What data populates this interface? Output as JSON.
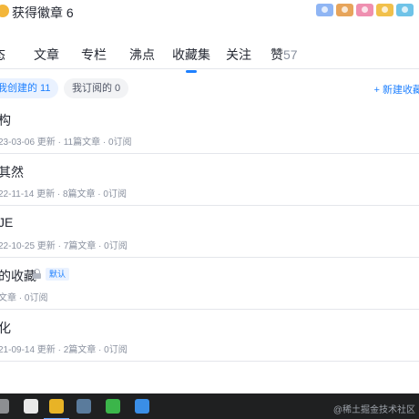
{
  "header": {
    "badge_title": "获得徽章 6",
    "medals": [
      {
        "icon": "medal-blue-icon",
        "color": "#8fb5f4"
      },
      {
        "icon": "medal-cap-icon",
        "color": "#e7a45a"
      },
      {
        "icon": "medal-pink-icon",
        "color": "#ef8fb0"
      },
      {
        "icon": "medal-gold-icon",
        "color": "#f1c04a"
      },
      {
        "icon": "medal-cyan-icon",
        "color": "#6fc3e8"
      }
    ]
  },
  "tabs": [
    {
      "label": "态",
      "count": ""
    },
    {
      "label": "文章",
      "count": ""
    },
    {
      "label": "专栏",
      "count": ""
    },
    {
      "label": "沸点",
      "count": ""
    },
    {
      "label": "收藏集",
      "count": "",
      "active": true
    },
    {
      "label": "关注",
      "count": ""
    },
    {
      "label": "赞",
      "count": "57"
    }
  ],
  "filters": {
    "created": "我创建的 11",
    "subscribed": "我订阅的 0",
    "new_collection": "+ 新建收藏"
  },
  "collections": [
    {
      "title": "构",
      "meta": "23-03-06 更新 · 11篇文章 · 0订阅"
    },
    {
      "title": "其然",
      "meta": "22-11-14 更新 · 8篇文章 · 0订阅"
    },
    {
      "title": "JE",
      "meta": "22-10-25 更新 · 7篇文章 · 0订阅"
    },
    {
      "title": "的收藏",
      "meta": "文章 · 0订阅",
      "locked": true,
      "tag": "默认"
    },
    {
      "title": "化",
      "meta": "21-09-14 更新 · 2篇文章 · 0订阅"
    }
  ],
  "taskbar": {
    "apps": [
      {
        "icon": "app-unknown-icon",
        "color": "#8d8f92"
      },
      {
        "icon": "qq-icon",
        "color": "#e9e9e9"
      },
      {
        "icon": "chrome-icon",
        "color": "#e8b326"
      },
      {
        "icon": "image-viewer-icon",
        "color": "#5a7b9c"
      },
      {
        "icon": "wechat-icon",
        "color": "#3bb54a"
      },
      {
        "icon": "feishu-icon",
        "color": "#3a8ee6"
      }
    ],
    "watermark": "@稀土掘金技术社区"
  }
}
